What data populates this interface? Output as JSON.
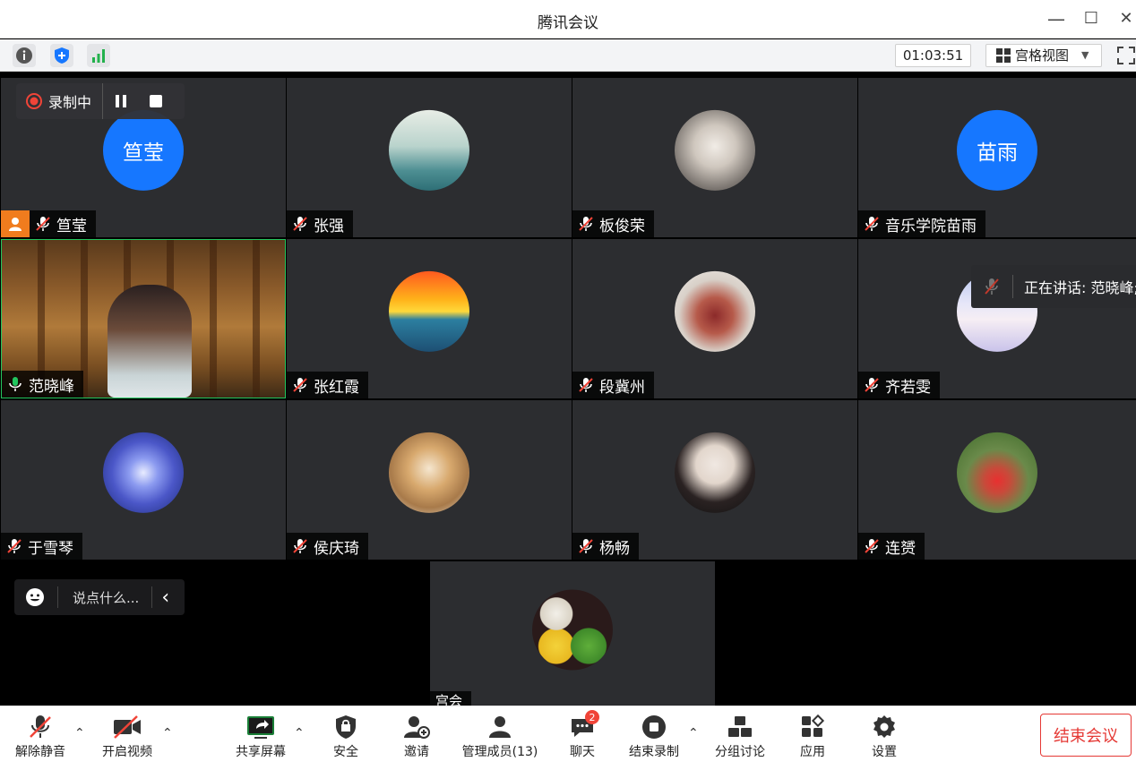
{
  "window": {
    "title": "腾讯会议",
    "min": "—",
    "max": "☐",
    "close": "✕"
  },
  "infobar": {
    "timer": "01:03:51",
    "view_label": "宫格视图",
    "view_caret": "▼"
  },
  "recording": {
    "label": "录制中"
  },
  "participants": [
    {
      "name": "笪莹",
      "avatar_text": "笪莹"
    },
    {
      "name": "张强"
    },
    {
      "name": "板俊荣"
    },
    {
      "name": "音乐学院苗雨",
      "avatar_text": "苗雨"
    },
    {
      "name": "范晓峰"
    },
    {
      "name": "张红霞"
    },
    {
      "name": "段冀州"
    },
    {
      "name": "齐若雯"
    },
    {
      "name": "于雪琴"
    },
    {
      "name": "侯庆琦"
    },
    {
      "name": "杨畅"
    },
    {
      "name": "连赟"
    },
    {
      "name": "宫会"
    }
  ],
  "speaking": {
    "label": "正在讲话: 范晓峰;"
  },
  "chat": {
    "placeholder": "说点什么...",
    "collapse": "‹"
  },
  "toolbar": {
    "unmute": "解除静音",
    "video": "开启视频",
    "share": "共享屏幕",
    "security": "安全",
    "invite": "邀请",
    "members": "管理成员(13)",
    "chat": "聊天",
    "chat_badge": "2",
    "stop_record": "结束录制",
    "breakout": "分组讨论",
    "apps": "应用",
    "settings": "设置",
    "end_meeting": "结束会议"
  }
}
